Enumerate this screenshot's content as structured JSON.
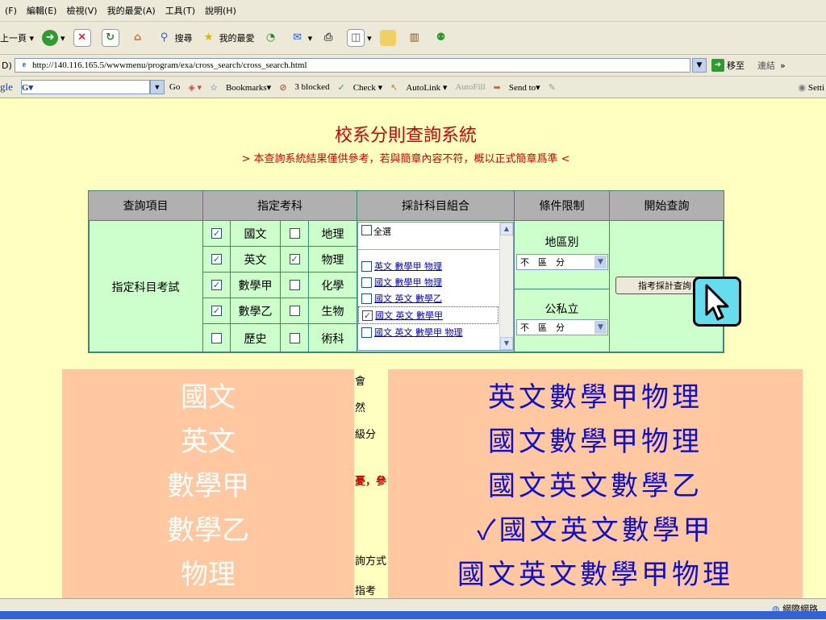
{
  "browser": {
    "menu": [
      "(F)",
      "編輯(E)",
      "檢視(V)",
      "我的最愛(A)",
      "工具(T)",
      "說明(H)"
    ],
    "toolbar": {
      "back": "上一頁",
      "search": "搜尋",
      "favorites": "我的最愛"
    },
    "address_label": "D)",
    "url": "http://140.116.165.5/wwwmenu/program/exa/cross_search/cross_search.html",
    "go": "移至",
    "links": "連結",
    "google": {
      "logo": "gle",
      "go": "Go",
      "bookmarks": "Bookmarks▾",
      "blocked": "3 blocked",
      "check": "Check ▾",
      "autolink": "AutoLink ▾",
      "autofill": "AutoFill",
      "sendto": "Send to▾",
      "settings": "Setti"
    }
  },
  "page": {
    "title": "校系分則查詢系統",
    "subtitle": "> 本查詢系統結果僅供參考，若與簡章內容不符，概以正式簡章爲準 <"
  },
  "table": {
    "headers": [
      "查詢項目",
      "指定考科",
      "採計科目組合",
      "條件限制",
      "開始查詢"
    ],
    "row_label": "指定科目考試",
    "subjects": [
      [
        {
          "name": "國文",
          "checked": true
        },
        {
          "name": "地理",
          "checked": false
        }
      ],
      [
        {
          "name": "英文",
          "checked": true
        },
        {
          "name": "物理",
          "checked": true
        }
      ],
      [
        {
          "name": "數學甲",
          "checked": true
        },
        {
          "name": "化學",
          "checked": false
        }
      ],
      [
        {
          "name": "數學乙",
          "checked": true
        },
        {
          "name": "生物",
          "checked": false
        }
      ],
      [
        {
          "name": "歷史",
          "checked": false
        },
        {
          "name": "術科",
          "checked": false
        }
      ]
    ],
    "combos": {
      "select_all": "全選",
      "items": [
        {
          "label": "英文 數學甲 物理",
          "checked": false
        },
        {
          "label": "國文 數學甲 物理",
          "checked": false
        },
        {
          "label": "國文 英文 數學乙",
          "checked": false
        },
        {
          "label": "國文 英文 數學甲",
          "checked": true
        },
        {
          "label": "國文 英文 數學甲 物理",
          "checked": false
        }
      ]
    },
    "region_label": "地區別",
    "region_value": "不　區　分",
    "ownership_label": "公私立",
    "ownership_value": "不　區　分",
    "search_button": "指考採計查詢"
  },
  "overlay_left": [
    "國文",
    "英文",
    "數學甲",
    "數學乙",
    "物理"
  ],
  "overlay_right": [
    "英文數學甲物理",
    "國文數學甲物理",
    "國文英文數學乙",
    "✓國文英文數學甲",
    "國文英文數學甲物理"
  ],
  "behind_text": [
    "會",
    "然",
    "級分",
    "憂，參",
    "詢方式",
    "指考"
  ],
  "status": {
    "zone": "網際網路"
  }
}
